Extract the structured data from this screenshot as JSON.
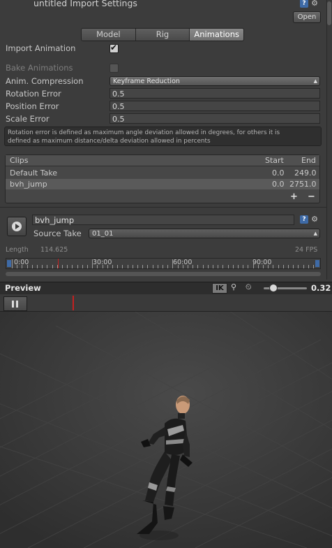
{
  "header": {
    "title": "untitled Import Settings",
    "open_label": "Open"
  },
  "tabs": [
    {
      "label": "Model",
      "active": false
    },
    {
      "label": "Rig",
      "active": false
    },
    {
      "label": "Animations",
      "active": true
    }
  ],
  "settings": {
    "import_animation_label": "Import Animation",
    "import_animation_checked": true,
    "bake_animations_label": "Bake Animations",
    "bake_animations_checked": false,
    "anim_compression_label": "Anim. Compression",
    "anim_compression_value": "Keyframe Reduction",
    "rotation_error_label": "Rotation Error",
    "rotation_error_value": "0.5",
    "position_error_label": "Position Error",
    "position_error_value": "0.5",
    "scale_error_label": "Scale Error",
    "scale_error_value": "0.5"
  },
  "help_text": {
    "line1": "Rotation error is defined as maximum angle deviation allowed in degrees, for others it is",
    "line2": "defined as maximum distance/delta deviation allowed in percents"
  },
  "clips": {
    "header": {
      "name": "Clips",
      "start": "Start",
      "end": "End"
    },
    "rows": [
      {
        "name": "Default Take",
        "start": "0.0",
        "end": "249.0",
        "selected": false
      },
      {
        "name": "bvh_jump",
        "start": "0.0",
        "end": "2751.0",
        "selected": true
      }
    ],
    "add_label": "+",
    "remove_label": "−"
  },
  "clip": {
    "name": "bvh_jump",
    "source_take_label": "Source Take",
    "source_take_value": "01_01",
    "length_label": "Length",
    "length_value": "114.625",
    "fps": "24 FPS",
    "timeline_labels": [
      "0:00",
      "30:00",
      "60:00",
      "90:00"
    ]
  },
  "preview": {
    "title": "Preview",
    "ik_label": "IK",
    "speed": "0.32",
    "speed_fraction": 0.15
  },
  "colors": {
    "accent_blue": "#3e6aa6",
    "playhead_red": "#c42020"
  },
  "icons": [
    "help-icon",
    "gear-icon",
    "play-icon",
    "pause-icon",
    "pivot-icon",
    "speed-icon",
    "chevron-icon"
  ]
}
